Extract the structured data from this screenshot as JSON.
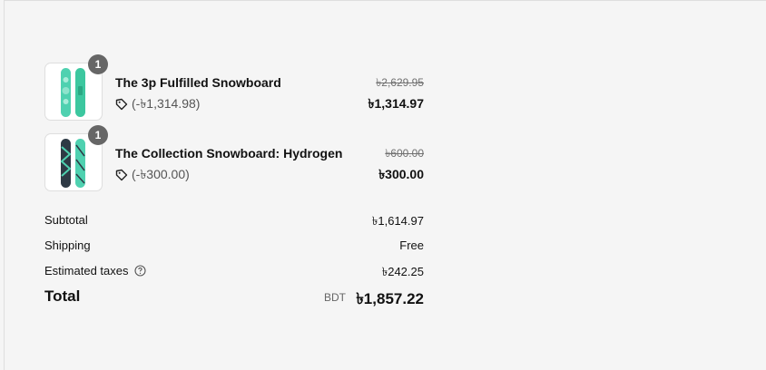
{
  "line_items": [
    {
      "quantity": "1",
      "name": "The 3p Fulfilled Snowboard",
      "discount": "(-৳1,314.98)",
      "original_price": "৳2,629.95",
      "final_price": "৳1,314.97"
    },
    {
      "quantity": "1",
      "name": "The Collection Snowboard: Hydrogen",
      "discount": "(-৳300.00)",
      "original_price": "৳600.00",
      "final_price": "৳300.00"
    }
  ],
  "totals": {
    "subtotal_label": "Subtotal",
    "subtotal_value": "৳1,614.97",
    "shipping_label": "Shipping",
    "shipping_value": "Free",
    "taxes_label": "Estimated taxes",
    "taxes_value": "৳242.25",
    "total_label": "Total",
    "currency_code": "BDT",
    "total_value": "৳1,857.22"
  },
  "icons": {
    "discount": "tag-icon",
    "taxes_info": "help-circle-icon"
  },
  "colors": {
    "badge": "#666666",
    "background": "#f5f5f5",
    "snowboard_teal": "#4fd1b0"
  }
}
